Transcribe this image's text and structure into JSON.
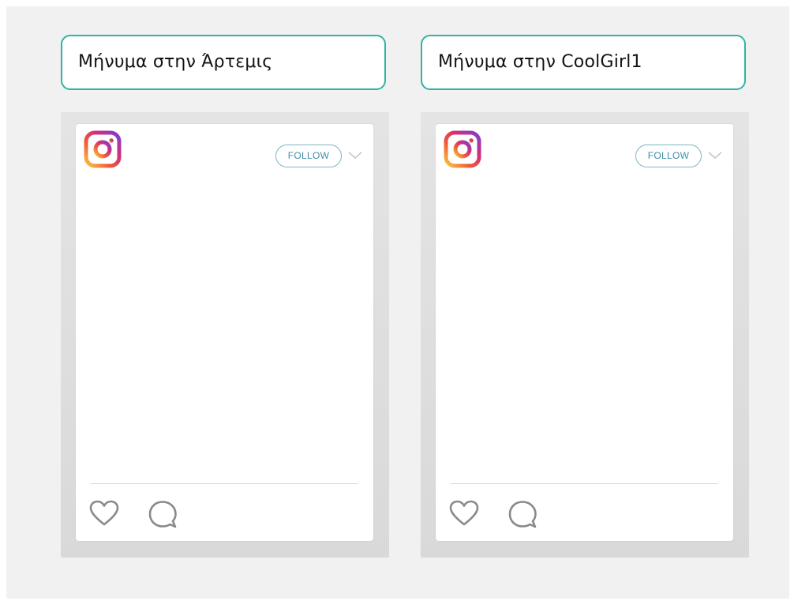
{
  "posts": [
    {
      "message_label": "Μήνυμα στην Άρτεμις",
      "follow_label": "FOLLOW",
      "icons": [
        "instagram-logo",
        "chevron-down",
        "heart",
        "comment"
      ]
    },
    {
      "message_label": "Μήνυμα στην CoolGirl1",
      "follow_label": "FOLLOW",
      "icons": [
        "instagram-logo",
        "chevron-down",
        "heart",
        "comment"
      ]
    }
  ],
  "colors": {
    "message_border": "#2fb3a3",
    "follow_border": "#7fb6c4",
    "follow_text": "#3e8fa6",
    "background": "#f1f1f1"
  }
}
